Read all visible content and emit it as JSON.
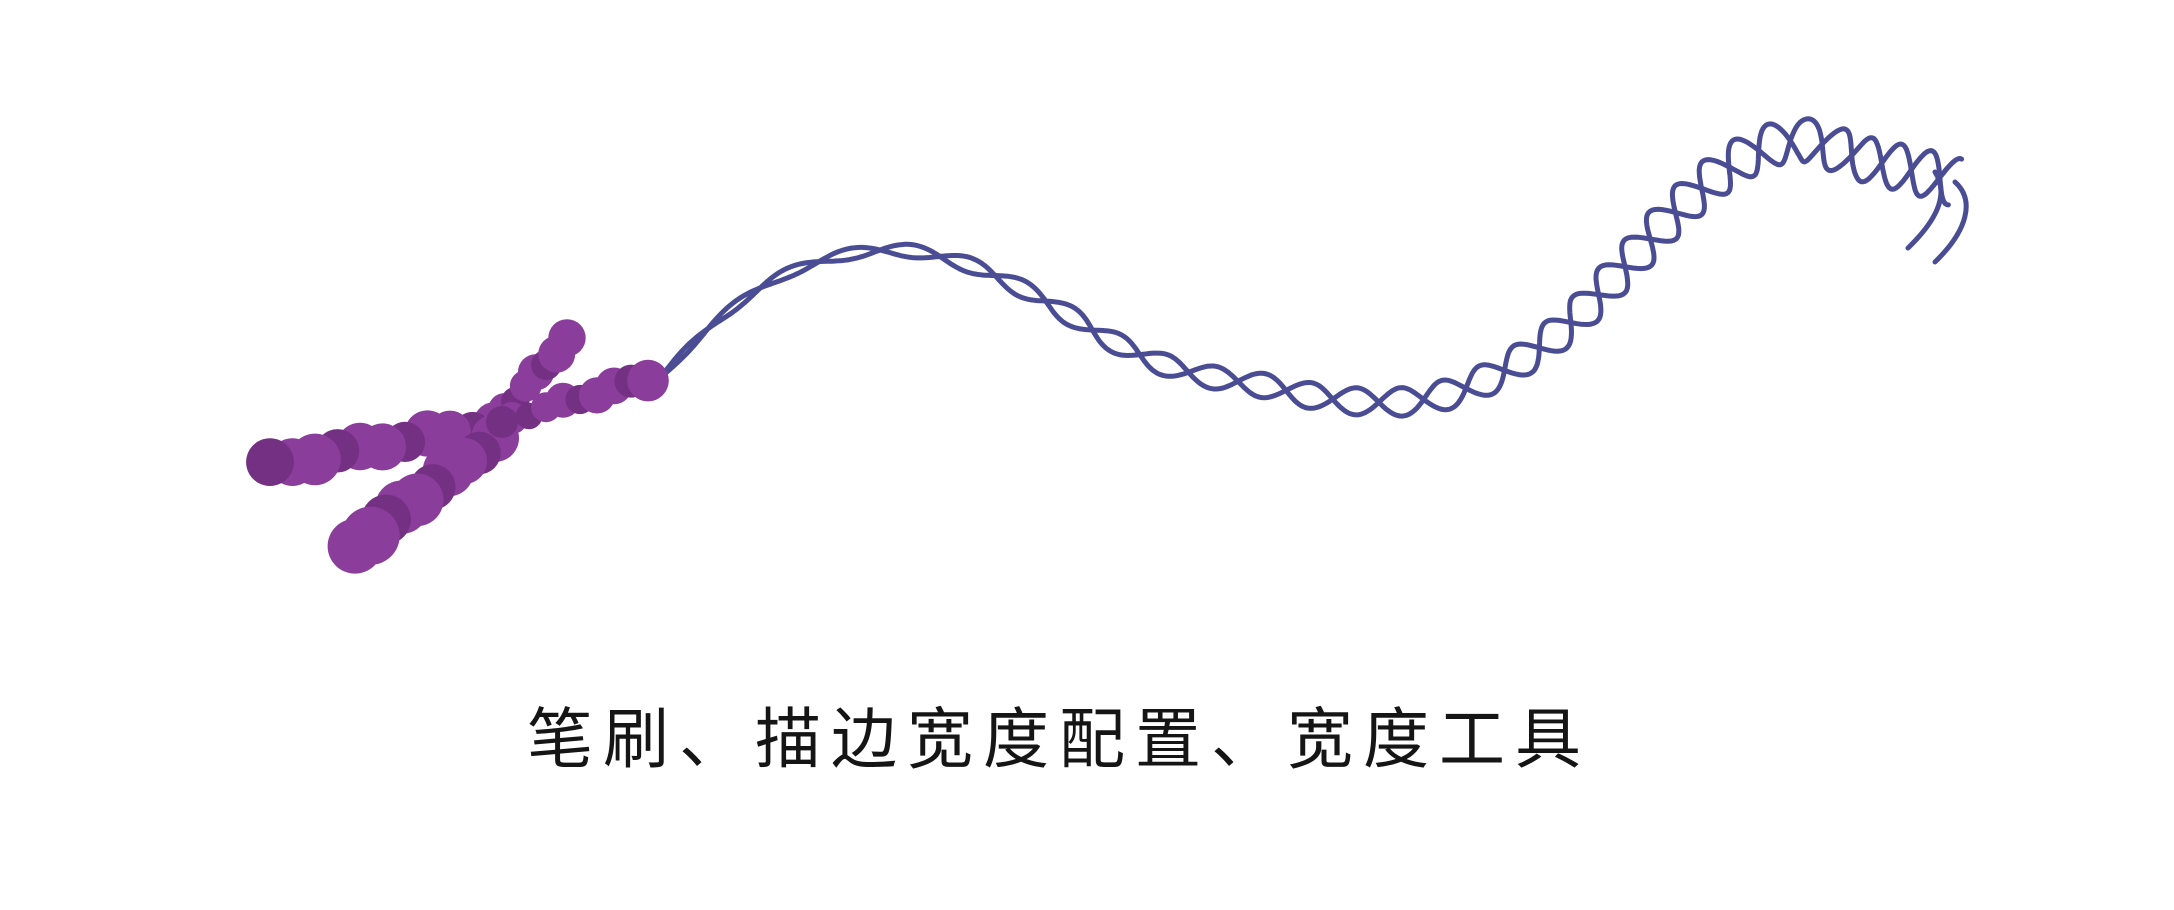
{
  "caption": "笔刷、描边宽度配置、宽度工具",
  "colors": {
    "background": "#ffffff",
    "chromosome": "#8a3d9a",
    "chromosome_shadow": "#743083",
    "dna_strand": "#4a4d94",
    "caption_text": "#151515"
  }
}
